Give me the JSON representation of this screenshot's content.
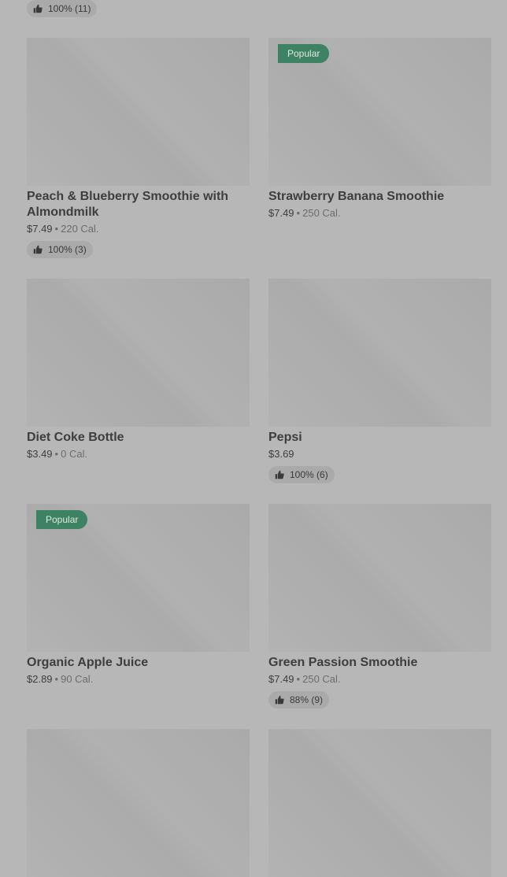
{
  "top_rating": "100% (11)",
  "items": [
    {
      "name": "Peach & Blueberry Smoothie with Almondmilk",
      "price": "$7.49",
      "calories": "220 Cal.",
      "rating": "100% (3)",
      "badge": ""
    },
    {
      "name": "Strawberry Banana Smoothie",
      "price": "$7.49",
      "calories": "250 Cal.",
      "rating": "",
      "badge": "Popular"
    },
    {
      "name": "Diet Coke Bottle",
      "price": "$3.49",
      "calories": "0 Cal.",
      "rating": "",
      "badge": ""
    },
    {
      "name": "Pepsi",
      "price": "$3.69",
      "calories": "",
      "rating": "100% (6)",
      "badge": ""
    },
    {
      "name": "Organic Apple Juice",
      "price": "$2.89",
      "calories": "90 Cal.",
      "rating": "",
      "badge": "Popular"
    },
    {
      "name": "Green Passion Smoothie",
      "price": "$7.49",
      "calories": "250 Cal.",
      "rating": "88% (9)",
      "badge": ""
    },
    {
      "name": "",
      "price": "",
      "calories": "",
      "rating": "",
      "badge": ""
    },
    {
      "name": "",
      "price": "",
      "calories": "",
      "rating": "",
      "badge": ""
    }
  ],
  "separator": "•"
}
